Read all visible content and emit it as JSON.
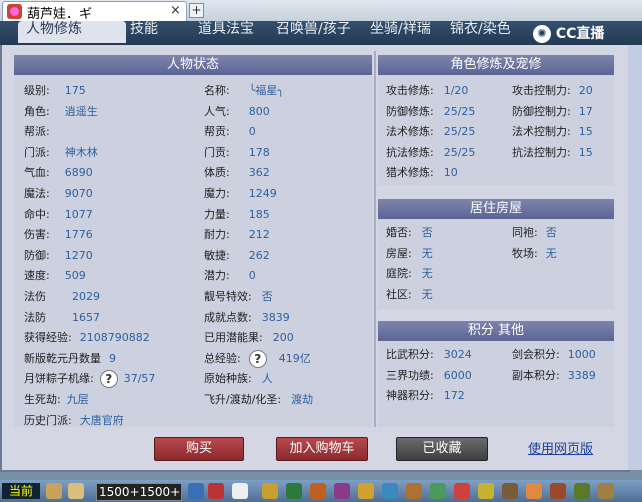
{
  "browser": {
    "tab_title": "葫芦娃．ギ",
    "close_glyph": "×",
    "new_tab_glyph": "+"
  },
  "game_nav": {
    "tabs": [
      "人物修炼",
      "技能",
      "道具法宝",
      "召唤兽/孩子",
      "坐骑/祥瑞",
      "锦衣/染色"
    ],
    "logo_text": "CC直播"
  },
  "character": {
    "header": "人物状态",
    "left_rows": [
      {
        "label": "级别:",
        "value": "175"
      },
      {
        "label": "角色:",
        "value": "逍遥生"
      },
      {
        "label": "帮派:",
        "value": ""
      },
      {
        "label": "门派:",
        "value": "神木林"
      },
      {
        "label": "气血:",
        "value": "6890"
      },
      {
        "label": "魔法:",
        "value": "9070"
      },
      {
        "label": "命中:",
        "value": "1077"
      },
      {
        "label": "伤害:",
        "value": "1776"
      },
      {
        "label": "防御:",
        "value": "1270"
      },
      {
        "label": "速度:",
        "value": "509"
      },
      {
        "label": "法伤",
        "value": "2029"
      },
      {
        "label": "法防",
        "value": "1657"
      },
      {
        "label": "获得经验:",
        "value": "2108790882"
      },
      {
        "label": "新版乾元丹数量",
        "value": "9"
      },
      {
        "label": "月饼粽子机缘:",
        "value": "37/57"
      },
      {
        "label": "生死劫:",
        "value": "九层"
      },
      {
        "label": "历史门派:",
        "value": "大唐官府"
      }
    ],
    "right_rows": [
      {
        "label": "名称:",
        "value": "╰福星╮"
      },
      {
        "label": "人气:",
        "value": "800"
      },
      {
        "label": "帮贡:",
        "value": "0"
      },
      {
        "label": "门贡:",
        "value": "178"
      },
      {
        "label": "体质:",
        "value": "362"
      },
      {
        "label": "魔力:",
        "value": "1249"
      },
      {
        "label": "力量:",
        "value": "185"
      },
      {
        "label": "耐力:",
        "value": "212"
      },
      {
        "label": "敏捷:",
        "value": "262"
      },
      {
        "label": "潜力:",
        "value": "0"
      },
      {
        "label": "靓号特效:",
        "value": "否"
      },
      {
        "label": "成就点数:",
        "value": "3839"
      },
      {
        "label": "已用潜能果:",
        "value": "200"
      },
      {
        "label": "总经验:",
        "value": "419亿"
      },
      {
        "label": "原始种族:",
        "value": "人"
      },
      {
        "label": "飞升/渡劫/化圣:",
        "value": "渡劫"
      }
    ],
    "help_glyph": "?"
  },
  "cultivation": {
    "header": "角色修炼及宠修",
    "rows": [
      {
        "l_label": "攻击修炼:",
        "l_value": "1/20",
        "r_label": "攻击控制力:",
        "r_value": "20"
      },
      {
        "l_label": "防御修炼:",
        "l_value": "25/25",
        "r_label": "防御控制力:",
        "r_value": "17"
      },
      {
        "l_label": "法术修炼:",
        "l_value": "25/25",
        "r_label": "法术控制力:",
        "r_value": "15"
      },
      {
        "l_label": "抗法修炼:",
        "l_value": "25/25",
        "r_label": "抗法控制力:",
        "r_value": "15"
      },
      {
        "l_label": "猎术修炼:",
        "l_value": "10",
        "r_label": "",
        "r_value": ""
      }
    ]
  },
  "housing": {
    "header": "居住房屋",
    "rows": [
      {
        "l_label": "婚否:",
        "l_value": "否",
        "r_label": "同袍:",
        "r_value": "否"
      },
      {
        "l_label": "房屋:",
        "l_value": "无",
        "r_label": "牧场:",
        "r_value": "无"
      },
      {
        "l_label": "庭院:",
        "l_value": "无",
        "r_label": "",
        "r_value": ""
      },
      {
        "l_label": "社区:",
        "l_value": "无",
        "r_label": "",
        "r_value": ""
      }
    ]
  },
  "points": {
    "header": "积分 其他",
    "rows": [
      {
        "l_label": "比武积分:",
        "l_value": "3024",
        "r_label": "剑会积分:",
        "r_value": "1000"
      },
      {
        "l_label": "三界功绩:",
        "l_value": "6000",
        "r_label": "副本积分:",
        "r_value": "3389"
      },
      {
        "l_label": "神器积分:",
        "l_value": "172",
        "r_label": "",
        "r_value": ""
      }
    ]
  },
  "actions": {
    "buy": "购买",
    "add_cart": "加入购物车",
    "collected": "已收藏",
    "web_version": "使用网页版"
  },
  "taskbar": {
    "current": "当前",
    "input_text": "1500+1500+"
  }
}
